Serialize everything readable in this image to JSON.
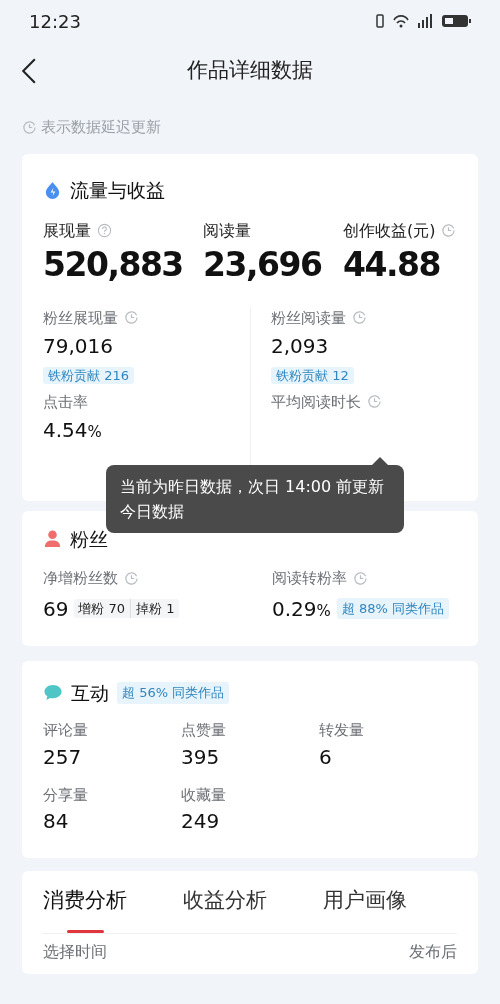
{
  "status_bar": {
    "time": "12:23"
  },
  "header": {
    "title": "作品详细数据"
  },
  "note": {
    "text": "表示数据延迟更新"
  },
  "traffic": {
    "title": "流量与收益",
    "metrics": [
      {
        "label": "展现量",
        "kind": "help",
        "value": "520,883"
      },
      {
        "label": "阅读量",
        "kind": "plain",
        "value": "23,696"
      },
      {
        "label": "创作收益(元)",
        "kind": "delayed",
        "value": "44.88"
      }
    ],
    "details": [
      {
        "label": "粉丝展现量",
        "clock": true,
        "value": "79,016",
        "badge": "铁粉贡献 216"
      },
      {
        "label": "粉丝阅读量",
        "clock": true,
        "value": "2,093",
        "badge": "铁粉贡献 12"
      },
      {
        "label": "点击率",
        "clock": false,
        "value": "4.54",
        "unit": "%"
      },
      {
        "label": "平均阅读时长",
        "clock": true
      }
    ]
  },
  "tooltip": {
    "text": "当前为昨日数据，次日 14:00 前更新今日数据"
  },
  "fans": {
    "title": "粉丝",
    "metrics": [
      {
        "label": "净增粉丝数",
        "clock": true,
        "value": "69",
        "breakdown": [
          "增粉 70",
          "掉粉 1"
        ]
      },
      {
        "label": "阅读转粉率",
        "clock": true,
        "value": "0.29",
        "unit": "%",
        "badge": "超 88% 同类作品"
      }
    ]
  },
  "interaction": {
    "title": "互动",
    "badge": "超 56% 同类作品",
    "metrics": [
      {
        "label": "评论量",
        "value": "257"
      },
      {
        "label": "点赞量",
        "value": "395"
      },
      {
        "label": "转发量",
        "value": "6"
      },
      {
        "label": "分享量",
        "value": "84"
      },
      {
        "label": "收藏量",
        "value": "249"
      }
    ]
  },
  "tabs": [
    {
      "label": "消费分析",
      "selected": true
    },
    {
      "label": "收益分析",
      "selected": false
    },
    {
      "label": "用户画像",
      "selected": false
    }
  ],
  "filter": {
    "label": "选择时间",
    "right": "发布后"
  }
}
